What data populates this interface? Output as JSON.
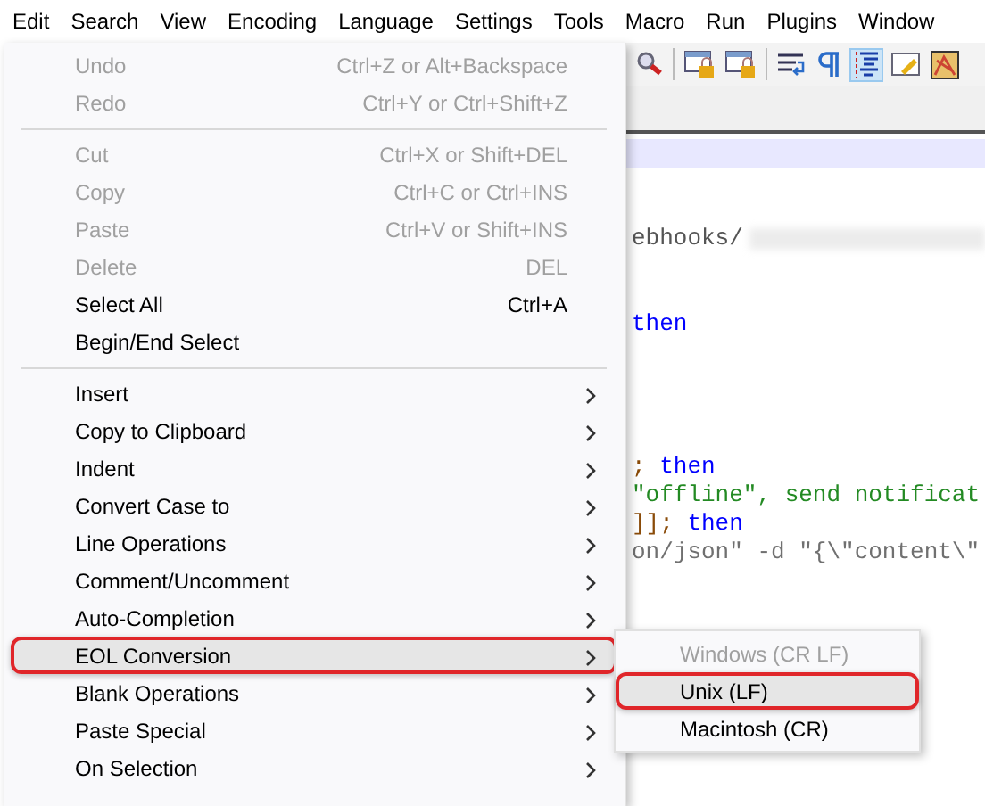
{
  "menubar": [
    {
      "label": "Edit"
    },
    {
      "label": "Search"
    },
    {
      "label": "View"
    },
    {
      "label": "Encoding"
    },
    {
      "label": "Language"
    },
    {
      "label": "Settings"
    },
    {
      "label": "Tools"
    },
    {
      "label": "Macro"
    },
    {
      "label": "Run"
    },
    {
      "label": "Plugins"
    },
    {
      "label": "Window"
    }
  ],
  "edit_menu": [
    {
      "kind": "item",
      "label": "Undo",
      "shortcut": "Ctrl+Z or Alt+Backspace",
      "disabled": true,
      "selected": false
    },
    {
      "kind": "item",
      "label": "Redo",
      "shortcut": "Ctrl+Y or Ctrl+Shift+Z",
      "disabled": true,
      "selected": false
    },
    {
      "kind": "separator"
    },
    {
      "kind": "item",
      "label": "Cut",
      "shortcut": "Ctrl+X or Shift+DEL",
      "disabled": true,
      "selected": false
    },
    {
      "kind": "item",
      "label": "Copy",
      "shortcut": "Ctrl+C or Ctrl+INS",
      "disabled": true,
      "selected": false
    },
    {
      "kind": "item",
      "label": "Paste",
      "shortcut": "Ctrl+V or Shift+INS",
      "disabled": true,
      "selected": false
    },
    {
      "kind": "item",
      "label": "Delete",
      "shortcut": "DEL",
      "disabled": true,
      "selected": false
    },
    {
      "kind": "item",
      "label": "Select All",
      "shortcut": "Ctrl+A",
      "disabled": false,
      "selected": false
    },
    {
      "kind": "item",
      "label": "Begin/End Select",
      "disabled": false,
      "selected": false
    },
    {
      "kind": "separator"
    },
    {
      "kind": "submenu",
      "label": "Insert",
      "disabled": false,
      "selected": false
    },
    {
      "kind": "submenu",
      "label": "Copy to Clipboard",
      "disabled": false,
      "selected": false
    },
    {
      "kind": "submenu",
      "label": "Indent",
      "disabled": false,
      "selected": false
    },
    {
      "kind": "submenu",
      "label": "Convert Case to",
      "disabled": false,
      "selected": false
    },
    {
      "kind": "submenu",
      "label": "Line Operations",
      "disabled": false,
      "selected": false
    },
    {
      "kind": "submenu",
      "label": "Comment/Uncomment",
      "disabled": false,
      "selected": false
    },
    {
      "kind": "submenu",
      "label": "Auto-Completion",
      "disabled": false,
      "selected": false
    },
    {
      "kind": "submenu",
      "label": "EOL Conversion",
      "disabled": false,
      "selected": true,
      "submenu": [
        {
          "label": "Windows (CR LF)",
          "disabled": true,
          "selected": false
        },
        {
          "label": "Unix (LF)",
          "disabled": false,
          "selected": true
        },
        {
          "label": "Macintosh (CR)",
          "disabled": false,
          "selected": false
        }
      ]
    },
    {
      "kind": "submenu",
      "label": "Blank Operations",
      "disabled": false,
      "selected": false
    },
    {
      "kind": "submenu",
      "label": "Paste Special",
      "disabled": false,
      "selected": false
    },
    {
      "kind": "submenu",
      "label": "On Selection",
      "disabled": false,
      "selected": false
    }
  ],
  "editor": {
    "lines": [
      {
        "kind": "current"
      },
      {
        "kind": "blank"
      },
      {
        "kind": "blank"
      },
      {
        "kind": "code",
        "segments": [
          {
            "kind": "plain",
            "text": "ebhooks/"
          },
          {
            "kind": "redacted"
          }
        ]
      },
      {
        "kind": "blank"
      },
      {
        "kind": "blank"
      },
      {
        "kind": "code",
        "segments": [
          {
            "kind": "keyword",
            "text": "then"
          }
        ]
      },
      {
        "kind": "blank"
      },
      {
        "kind": "blank"
      },
      {
        "kind": "blank"
      },
      {
        "kind": "blank"
      },
      {
        "kind": "code",
        "segments": [
          {
            "kind": "operator",
            "text": ";"
          },
          {
            "kind": "keyword",
            "text": " then"
          }
        ]
      },
      {
        "kind": "code",
        "segments": [
          {
            "kind": "string",
            "text": "\"offline\", send notificat"
          }
        ]
      },
      {
        "kind": "code",
        "segments": [
          {
            "kind": "operator",
            "text": "]];"
          },
          {
            "kind": "keyword",
            "text": " then"
          }
        ]
      },
      {
        "kind": "code",
        "segments": [
          {
            "kind": "quoted",
            "text": "on/json\" -d \"{\\\"content\\\""
          }
        ]
      }
    ]
  }
}
